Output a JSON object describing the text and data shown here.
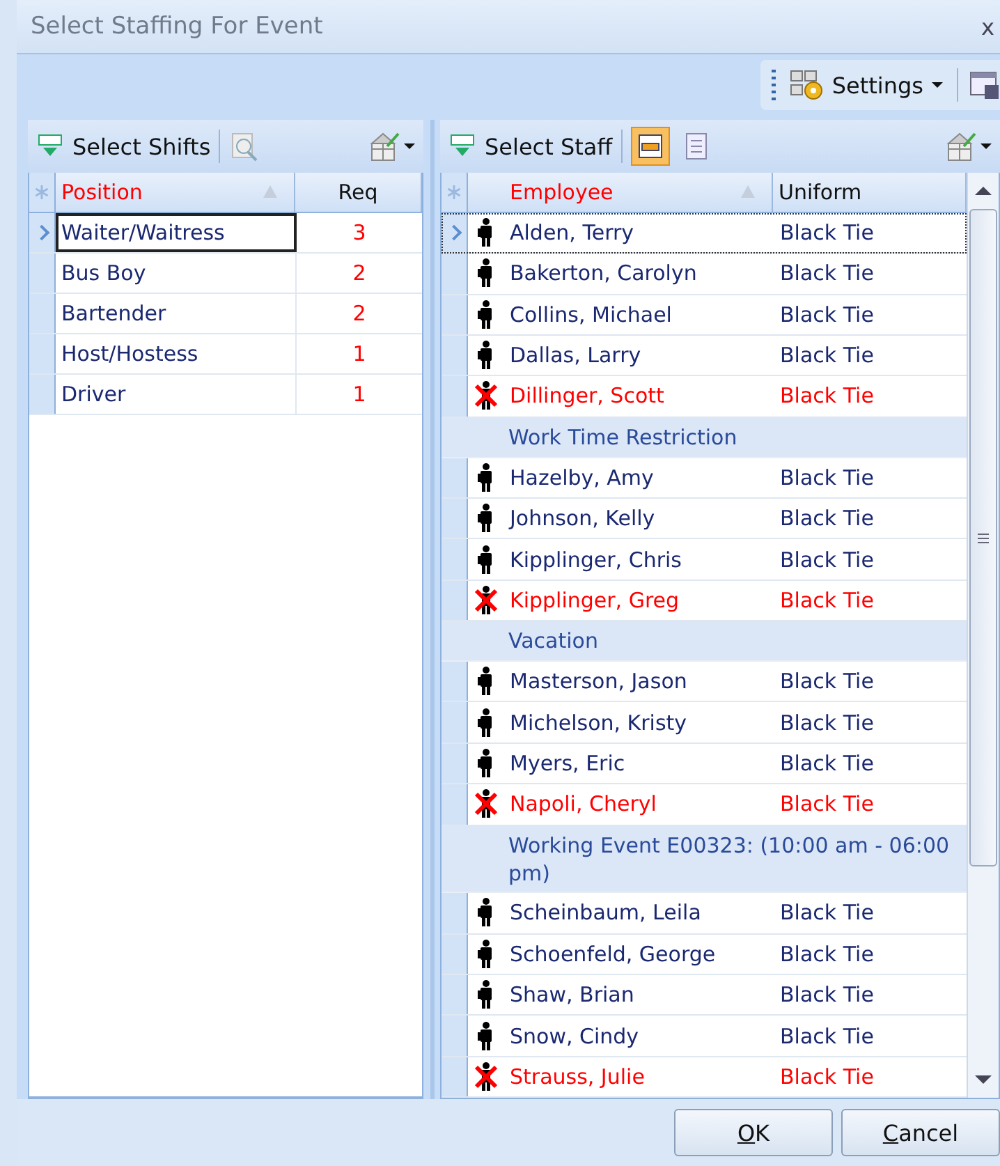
{
  "window": {
    "title": "Select Staffing For Event",
    "close": "x"
  },
  "toolbar": {
    "settings": "Settings"
  },
  "shifts": {
    "title": "Select Shifts",
    "columns": [
      "Position",
      "Req"
    ],
    "rows": [
      {
        "position": "Waiter/Waitress",
        "req": "3",
        "selected": true
      },
      {
        "position": "Bus Boy",
        "req": "2",
        "selected": false
      },
      {
        "position": "Bartender",
        "req": "2",
        "selected": false
      },
      {
        "position": "Host/Hostess",
        "req": "1",
        "selected": false
      },
      {
        "position": "Driver",
        "req": "1",
        "selected": false
      }
    ]
  },
  "staff": {
    "title": "Select Staff",
    "columns": [
      "Employee",
      "Uniform"
    ],
    "rows": [
      {
        "kind": "employee",
        "name": "Alden, Terry",
        "uniform": "Black Tie",
        "unavailable": false,
        "selected": true
      },
      {
        "kind": "employee",
        "name": "Bakerton, Carolyn",
        "uniform": "Black Tie",
        "unavailable": false,
        "selected": false
      },
      {
        "kind": "employee",
        "name": "Collins, Michael",
        "uniform": "Black Tie",
        "unavailable": false,
        "selected": false
      },
      {
        "kind": "employee",
        "name": "Dallas, Larry",
        "uniform": "Black Tie",
        "unavailable": false,
        "selected": false
      },
      {
        "kind": "employee",
        "name": "Dillinger, Scott",
        "uniform": "Black Tie",
        "unavailable": true,
        "selected": false
      },
      {
        "kind": "group",
        "name": "Work Time Restriction"
      },
      {
        "kind": "employee",
        "name": "Hazelby, Amy",
        "uniform": "Black Tie",
        "unavailable": false,
        "selected": false
      },
      {
        "kind": "employee",
        "name": "Johnson, Kelly",
        "uniform": "Black Tie",
        "unavailable": false,
        "selected": false
      },
      {
        "kind": "employee",
        "name": "Kipplinger, Chris",
        "uniform": "Black Tie",
        "unavailable": false,
        "selected": false
      },
      {
        "kind": "employee",
        "name": "Kipplinger, Greg",
        "uniform": "Black Tie",
        "unavailable": true,
        "selected": false
      },
      {
        "kind": "group",
        "name": "Vacation"
      },
      {
        "kind": "employee",
        "name": "Masterson, Jason",
        "uniform": "Black Tie",
        "unavailable": false,
        "selected": false
      },
      {
        "kind": "employee",
        "name": "Michelson, Kristy",
        "uniform": "Black Tie",
        "unavailable": false,
        "selected": false
      },
      {
        "kind": "employee",
        "name": "Myers, Eric",
        "uniform": "Black Tie",
        "unavailable": false,
        "selected": false
      },
      {
        "kind": "employee",
        "name": "Napoli, Cheryl",
        "uniform": "Black Tie",
        "unavailable": true,
        "selected": false
      },
      {
        "kind": "group",
        "name": "Working Event E00323: (10:00 am - 06:00 pm)"
      },
      {
        "kind": "employee",
        "name": "Scheinbaum, Leila",
        "uniform": "Black Tie",
        "unavailable": false,
        "selected": false
      },
      {
        "kind": "employee",
        "name": "Schoenfeld, George",
        "uniform": "Black Tie",
        "unavailable": false,
        "selected": false
      },
      {
        "kind": "employee",
        "name": "Shaw, Brian",
        "uniform": "Black Tie",
        "unavailable": false,
        "selected": false
      },
      {
        "kind": "employee",
        "name": "Snow, Cindy",
        "uniform": "Black Tie",
        "unavailable": false,
        "selected": false
      },
      {
        "kind": "employee",
        "name": "Strauss, Julie",
        "uniform": "Black Tie",
        "unavailable": true,
        "selected": false
      }
    ]
  },
  "buttons": [
    {
      "label": "OK"
    },
    {
      "label": "Cancel"
    }
  ]
}
